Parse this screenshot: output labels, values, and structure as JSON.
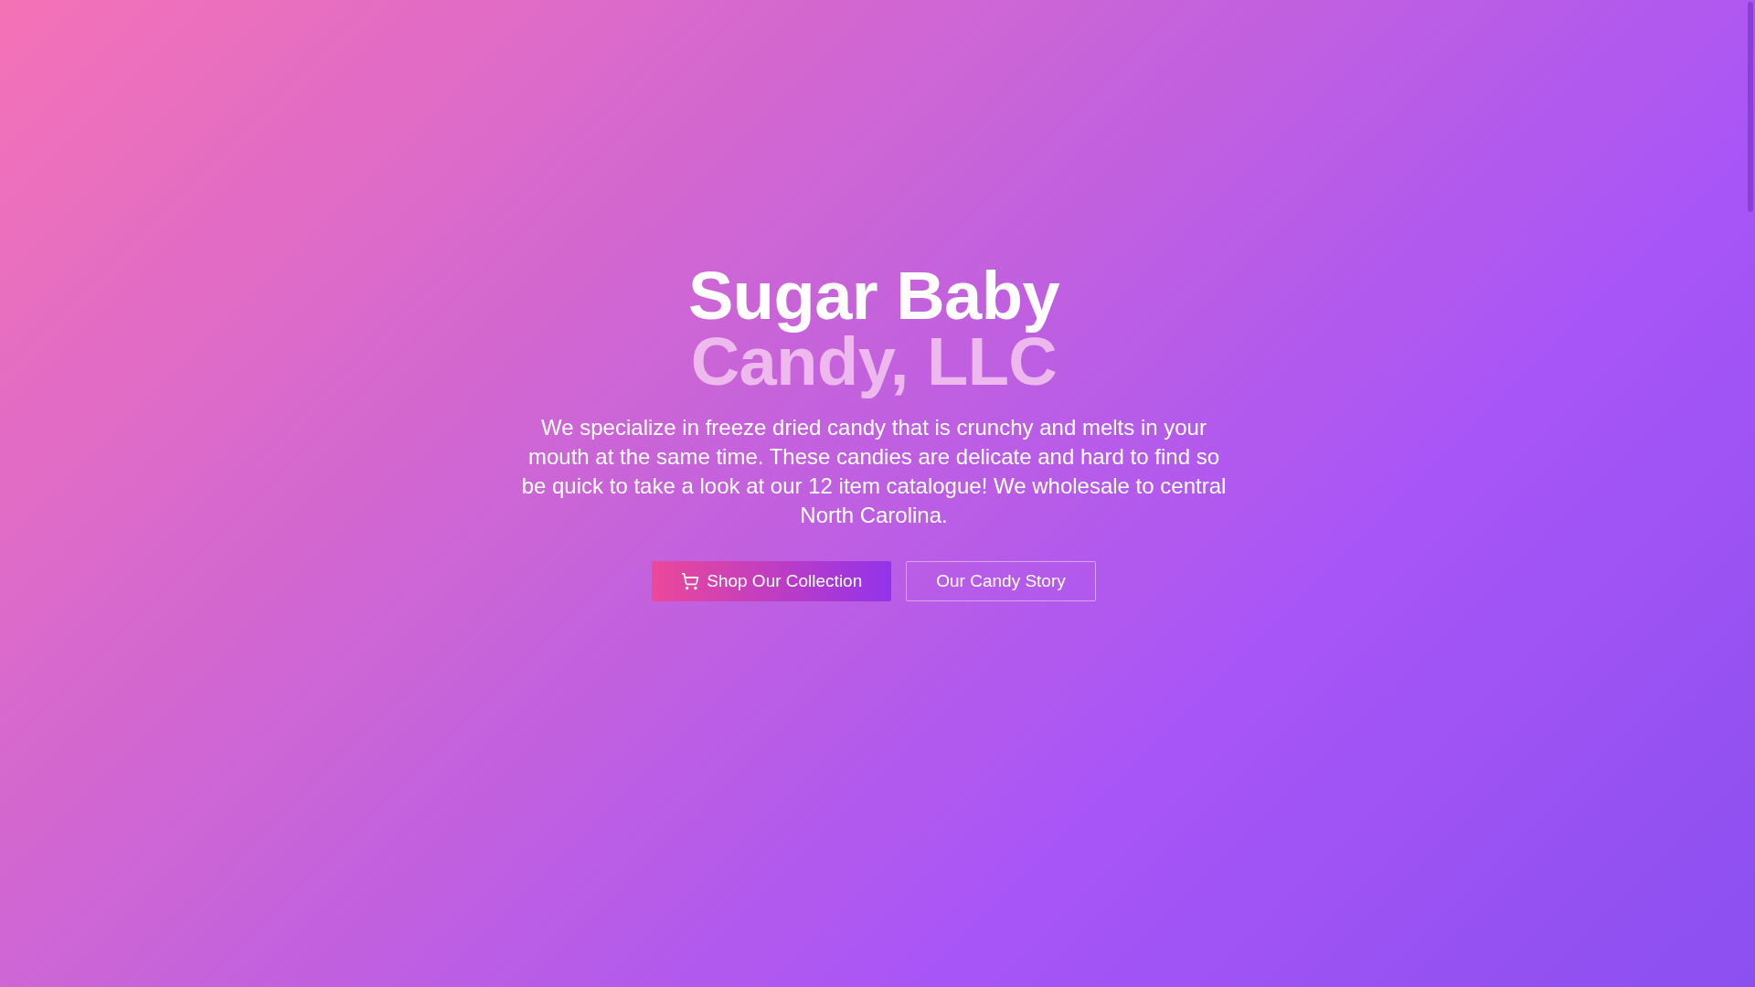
{
  "hero": {
    "title_line_1": "Sugar Baby",
    "title_line_2": "Candy, LLC",
    "description": "We specialize in freeze dried candy that is crunchy and melts in your mouth at the same time. These candies are delicate and hard to find so be quick to take a look at our 12 item catalogue! We wholesale to central North Carolina.",
    "buttons": [
      {
        "kind": "primary",
        "label": "Shop Our Collection"
      },
      {
        "kind": "outline",
        "label": "Our Candy Story"
      }
    ]
  }
}
